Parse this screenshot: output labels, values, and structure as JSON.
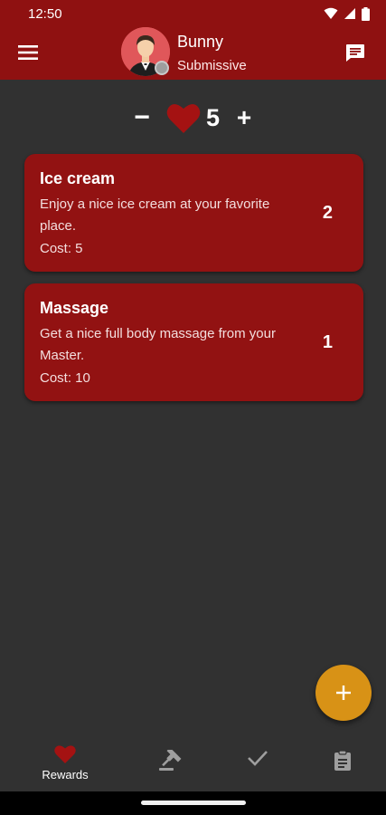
{
  "status_bar": {
    "time": "12:50",
    "icons": [
      "wifi-icon",
      "signal-icon",
      "battery-icon"
    ]
  },
  "app_bar": {
    "menu_icon": "hamburger-menu-icon",
    "user": {
      "name": "Bunny",
      "role": "Submissive"
    },
    "chat_icon": "chat-icon"
  },
  "points": {
    "minus_label": "−",
    "value": "5",
    "plus_label": "+",
    "icon": "heart-icon"
  },
  "rewards": [
    {
      "title": "Ice cream",
      "description": "Enjoy a nice ice cream at your favorite place.",
      "cost": "Cost: 5",
      "count": "2"
    },
    {
      "title": "Massage",
      "description": "Get a nice full body massage from your Master.",
      "cost": "Cost: 10",
      "count": "1"
    }
  ],
  "fab": {
    "icon": "plus-icon"
  },
  "bottom_nav": {
    "items": [
      {
        "label": "Rewards",
        "icon": "heart-icon",
        "active": true
      },
      {
        "label": "",
        "icon": "gavel-icon",
        "active": false
      },
      {
        "label": "",
        "icon": "check-icon",
        "active": false
      },
      {
        "label": "",
        "icon": "clipboard-icon",
        "active": false
      }
    ]
  },
  "colors": {
    "primary": "#8f1111",
    "background": "#313131",
    "card": "#921212",
    "accent": "#d89216"
  }
}
